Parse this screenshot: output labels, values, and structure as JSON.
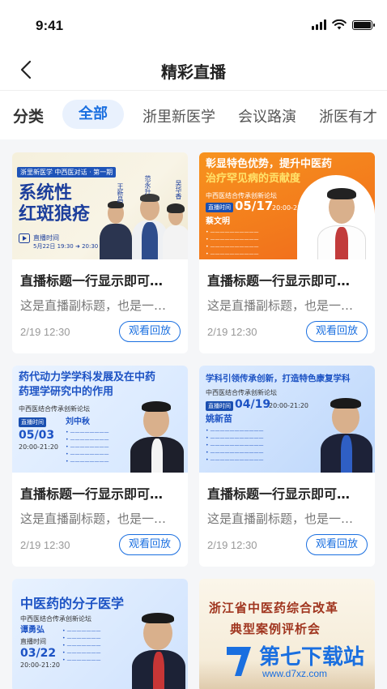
{
  "status": {
    "time": "9:41"
  },
  "nav": {
    "title": "精彩直播"
  },
  "categories": {
    "label": "分类",
    "tabs": [
      "全部",
      "浙里新医学",
      "会议路演",
      "浙医有才"
    ]
  },
  "cards": [
    {
      "title": "直播标题一行显示即可…",
      "subtitle": "这是直播副标题，也是一…",
      "date": "2/19 12:30",
      "button": "观看回放",
      "poster": {
        "tag": "浙里新医学 中西医对话 · 第一期",
        "headline_l1": "系统性",
        "headline_l2": "红斑狼疮",
        "live": "直播时间",
        "time": "5月22日 19:30 ➜ 20:30",
        "names": [
          "王新昌",
          "范永升",
          "吴华香"
        ]
      }
    },
    {
      "title": "直播标题一行显示即可…",
      "subtitle": "这是直播副标题，也是一…",
      "date": "2/19 12:30",
      "button": "观看回放",
      "poster": {
        "headline_l1": "彰显特色优势，提升中医药",
        "headline_l2": "治疗罕见病的贡献度",
        "forum": "中西医结合传承创新论坛",
        "live": "直播时间",
        "date": "05/17",
        "time": "20:00-21:20",
        "name": "蔡文明"
      }
    },
    {
      "title": "直播标题一行显示即可…",
      "subtitle": "这是直播副标题，也是一…",
      "date": "2/19 12:30",
      "button": "观看回放",
      "poster": {
        "headline_l1": "药代动力学学科发展及在中药",
        "headline_l2": "药理学研究中的作用",
        "forum": "中西医结合传承创新论坛",
        "live": "直播时间",
        "date": "05/03",
        "time": "20:00-21:20",
        "name": "刘中秋"
      }
    },
    {
      "title": "直播标题一行显示即可…",
      "subtitle": "这是直播副标题，也是一…",
      "date": "2/19 12:30",
      "button": "观看回放",
      "poster": {
        "headline_l1": "学科引领传承创新，打造特色康复学科",
        "forum": "中西医结合传承创新论坛",
        "live": "直播时间",
        "date": "04/19",
        "time": "20:00-21:20",
        "name": "姚新苗"
      }
    },
    {
      "poster": {
        "headline_l1": "中医药的分子医学",
        "forum": "中西医结合传承创新论坛",
        "name": "谭勇弘",
        "live": "直播时间",
        "date": "03/22",
        "time": "20:00-21:20"
      }
    },
    {
      "poster": {
        "headline_l1": "浙江省中医药综合改革",
        "headline_l2": "典型案例评析会"
      }
    }
  ],
  "watermark": {
    "brand": "第七下载站",
    "url": "www.d7xz.com"
  },
  "colors": {
    "accent": "#1a6fe0",
    "accent_bg": "#e9f1fd",
    "orange": "#f47c20"
  },
  "icons": [
    "back-chevron-icon",
    "signal-icon",
    "wifi-icon",
    "battery-icon",
    "play-icon"
  ]
}
